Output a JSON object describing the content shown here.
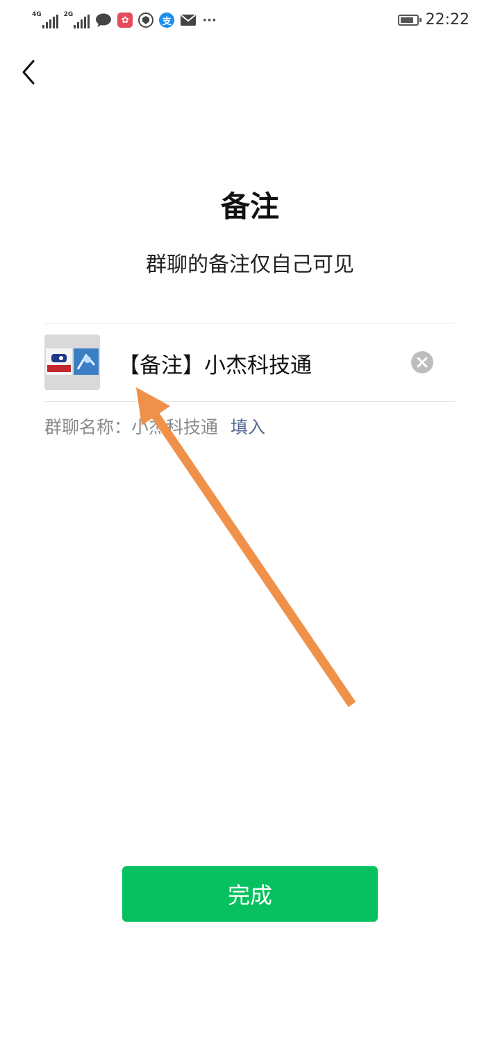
{
  "status_bar": {
    "network_1": "4G",
    "network_2": "2G",
    "time": "22:22",
    "more_dots": "···",
    "battery_fraction": 0.8,
    "icons": [
      "signal-4g-icon",
      "signal-2g-icon",
      "chat-bubble-icon",
      "huawei-app-icon",
      "shield-app-icon",
      "alipay-icon",
      "mail-icon",
      "more-icon",
      "battery-icon"
    ]
  },
  "header": {
    "back_icon": "chevron-left-icon"
  },
  "main": {
    "title": "备注",
    "subtitle": "群聊的备注仅自己可见",
    "remark_input": {
      "value": "【备注】小杰科技通",
      "placeholder": ""
    },
    "clear_icon": "clear-circle-icon",
    "group_name_label": "群聊名称：",
    "group_name_value": "小杰科技通",
    "fill_in_link": "填入"
  },
  "footer": {
    "done_label": "完成"
  },
  "colors": {
    "primary_green": "#07c160",
    "link_blue": "#576b95",
    "hint_gray": "#8a8a8a",
    "annotation_arrow": "#f0914a"
  }
}
